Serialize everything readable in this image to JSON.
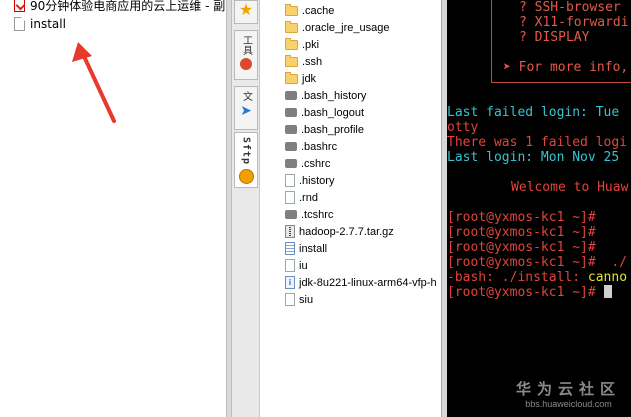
{
  "left_explorer": {
    "items": [
      {
        "label": "90分钟体验电商应用的云上运维 - 副",
        "icon": "pdf-icon"
      },
      {
        "label": "install",
        "icon": "file-icon"
      }
    ]
  },
  "sidebar": {
    "tabs": [
      {
        "label": "工具",
        "icon": "star-icon"
      },
      {
        "label": "文",
        "icon": "paper-plane-icon"
      },
      {
        "label": "Sftp",
        "icon": "orange-globe-icon"
      }
    ]
  },
  "sftp_files": [
    {
      "name": ".cache",
      "type": "folder"
    },
    {
      "name": ".oracle_jre_usage",
      "type": "folder"
    },
    {
      "name": ".pki",
      "type": "folder"
    },
    {
      "name": ".ssh",
      "type": "folder"
    },
    {
      "name": "jdk",
      "type": "folder"
    },
    {
      "name": ".bash_history",
      "type": "hidden"
    },
    {
      "name": ".bash_logout",
      "type": "hidden"
    },
    {
      "name": ".bash_profile",
      "type": "hidden"
    },
    {
      "name": ".bashrc",
      "type": "hidden"
    },
    {
      "name": ".cshrc",
      "type": "hidden"
    },
    {
      "name": ".history",
      "type": "plain"
    },
    {
      "name": ".rnd",
      "type": "plain"
    },
    {
      "name": ".tcshrc",
      "type": "hidden"
    },
    {
      "name": "hadoop-2.7.7.tar.gz",
      "type": "tgz"
    },
    {
      "name": "install",
      "type": "doc"
    },
    {
      "name": "iu",
      "type": "plain"
    },
    {
      "name": "jdk-8u221-linux-arm64-vfp-h",
      "type": "info"
    },
    {
      "name": "siu",
      "type": "plain"
    }
  ],
  "terminal": {
    "x11_lines": [
      "? SSH-browser",
      "? X11-forwardi",
      "? DISPLAY"
    ],
    "more_info": "➤ For more info,",
    "last_failed": "Last failed login: Tue",
    "otty": "otty",
    "failed_count": "There was 1 failed logi",
    "last_login": "Last login: Mon Nov 25",
    "welcome": "Welcome to Huaw",
    "prompt_lines": [
      "[root@yxmos-kc1 ~]#",
      "[root@yxmos-kc1 ~]#",
      "[root@yxmos-kc1 ~]#",
      "[root@yxmos-kc1 ~]#  ./"
    ],
    "bash_error_prefix": "-bash: ./install: ",
    "bash_error_suffix": "canno",
    "final_prompt": "[root@yxmos-kc1 ~]# "
  },
  "watermark": {
    "main": "华为云社区",
    "sub": "bbs.huaweicloud.com"
  },
  "colors": {
    "annotation_arrow": "#e8392a"
  }
}
